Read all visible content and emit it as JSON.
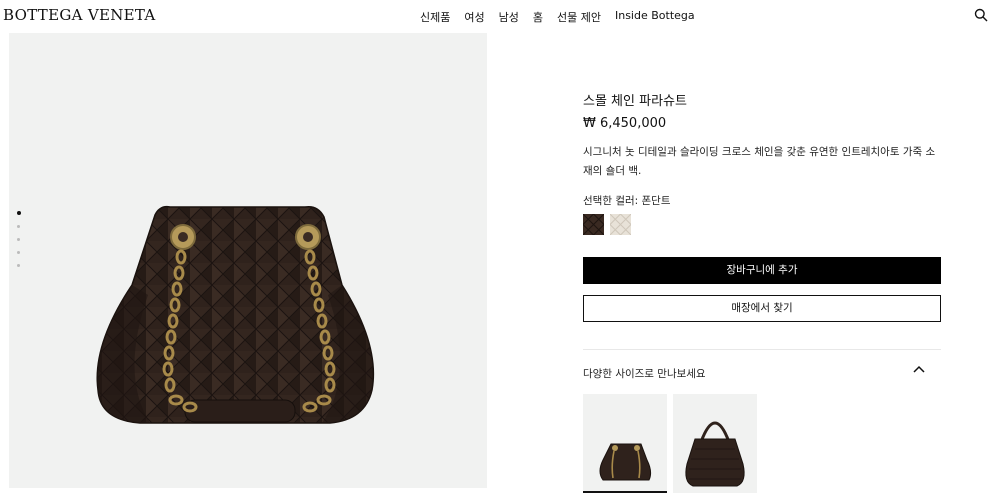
{
  "header": {
    "logo": "BOTTEGA VENETA",
    "nav": [
      "신제품",
      "여성",
      "남성",
      "홈",
      "선물 제안",
      "Inside Bottega"
    ]
  },
  "gallery": {
    "slide_count": 5,
    "active_slide": 1
  },
  "product": {
    "title": "스몰 체인 파라슈트",
    "price": "₩ 6,450,000",
    "description": "시그니처 놋 디테일과 슬라이딩 크로스 체인을 갖춘 유연한 인트레치아토 가죽 소재의 숄더 백.",
    "color_label": "선택한 컬러: 폰단트",
    "swatches": [
      {
        "name": "폰단트",
        "color": "#3a2a22",
        "selected": true
      },
      {
        "name": "크림",
        "color": "#e8e2d8",
        "selected": false
      }
    ],
    "add_to_cart": "장바구니에 추가",
    "find_in_store": "매장에서 찾기",
    "sizes_label": "다양한 사이즈로 만나보세요"
  },
  "colors": {
    "leather": "#2f221c",
    "hardware": "#b59a5a",
    "gallery_bg": "#f1f2f1"
  }
}
